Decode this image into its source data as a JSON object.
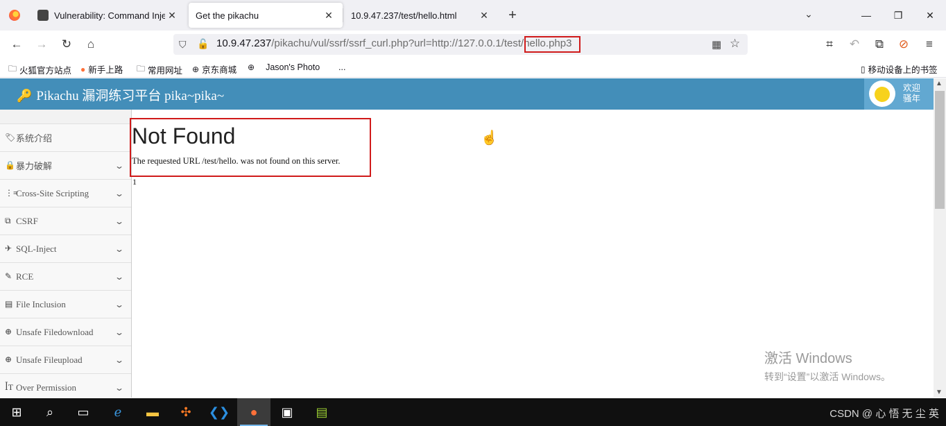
{
  "tabs": [
    {
      "title": "Vulnerability: Command Injec",
      "active": false
    },
    {
      "title": "Get the pikachu",
      "active": true
    },
    {
      "title": "10.9.47.237/test/hello.html",
      "active": false
    }
  ],
  "icons": {
    "close": "✕",
    "plus": "+",
    "chevron": "⌄",
    "minimize": "—",
    "restore": "❐",
    "back": "←",
    "forward": "→",
    "reload": "↻",
    "home": "⌂"
  },
  "url": {
    "host": "10.9.47.237",
    "path": "/pikachu/vul/ssrf/ssrf_curl.php?url=http://127.0.0.1/test/",
    "highlighted": "hello.php3"
  },
  "bookmarks": [
    "火狐官方站点",
    "新手上路",
    "常用网址",
    "京东商城",
    "Jason's Photo",
    "...",
    "移动设备上的书签"
  ],
  "app": {
    "brand": "Pikachu 漏洞练习平台 pika~pika~",
    "welcome_line1": "欢迎",
    "welcome_line2": "骚年"
  },
  "sidebar": {
    "items": [
      {
        "label": "系统介绍",
        "icon": "tags-icon",
        "expandable": false
      },
      {
        "label": "暴力破解",
        "icon": "lock-icon",
        "expandable": true
      },
      {
        "label": "Cross-Site Scripting",
        "icon": "list-icon",
        "expandable": true
      },
      {
        "label": "CSRF",
        "icon": "share-icon",
        "expandable": true
      },
      {
        "label": "SQL-Inject",
        "icon": "plane-icon",
        "expandable": true
      },
      {
        "label": "RCE",
        "icon": "pencil-icon",
        "expandable": true
      },
      {
        "label": "File Inclusion",
        "icon": "file-icon",
        "expandable": true
      },
      {
        "label": "Unsafe Filedownload",
        "icon": "download-icon",
        "expandable": true
      },
      {
        "label": "Unsafe Fileupload",
        "icon": "upload-icon",
        "expandable": true
      },
      {
        "label": "Over Permission",
        "icon": "text-height-icon",
        "expandable": true
      }
    ]
  },
  "content": {
    "title": "Not Found",
    "message": "The requested URL /test/hello. was not found on this server.",
    "trailing": "1"
  },
  "watermark": {
    "line1": "激活 Windows",
    "line2": "转到“设置”以激活 Windows。"
  },
  "tray_text": "CSDN @ 心 悟 无 尘  英"
}
